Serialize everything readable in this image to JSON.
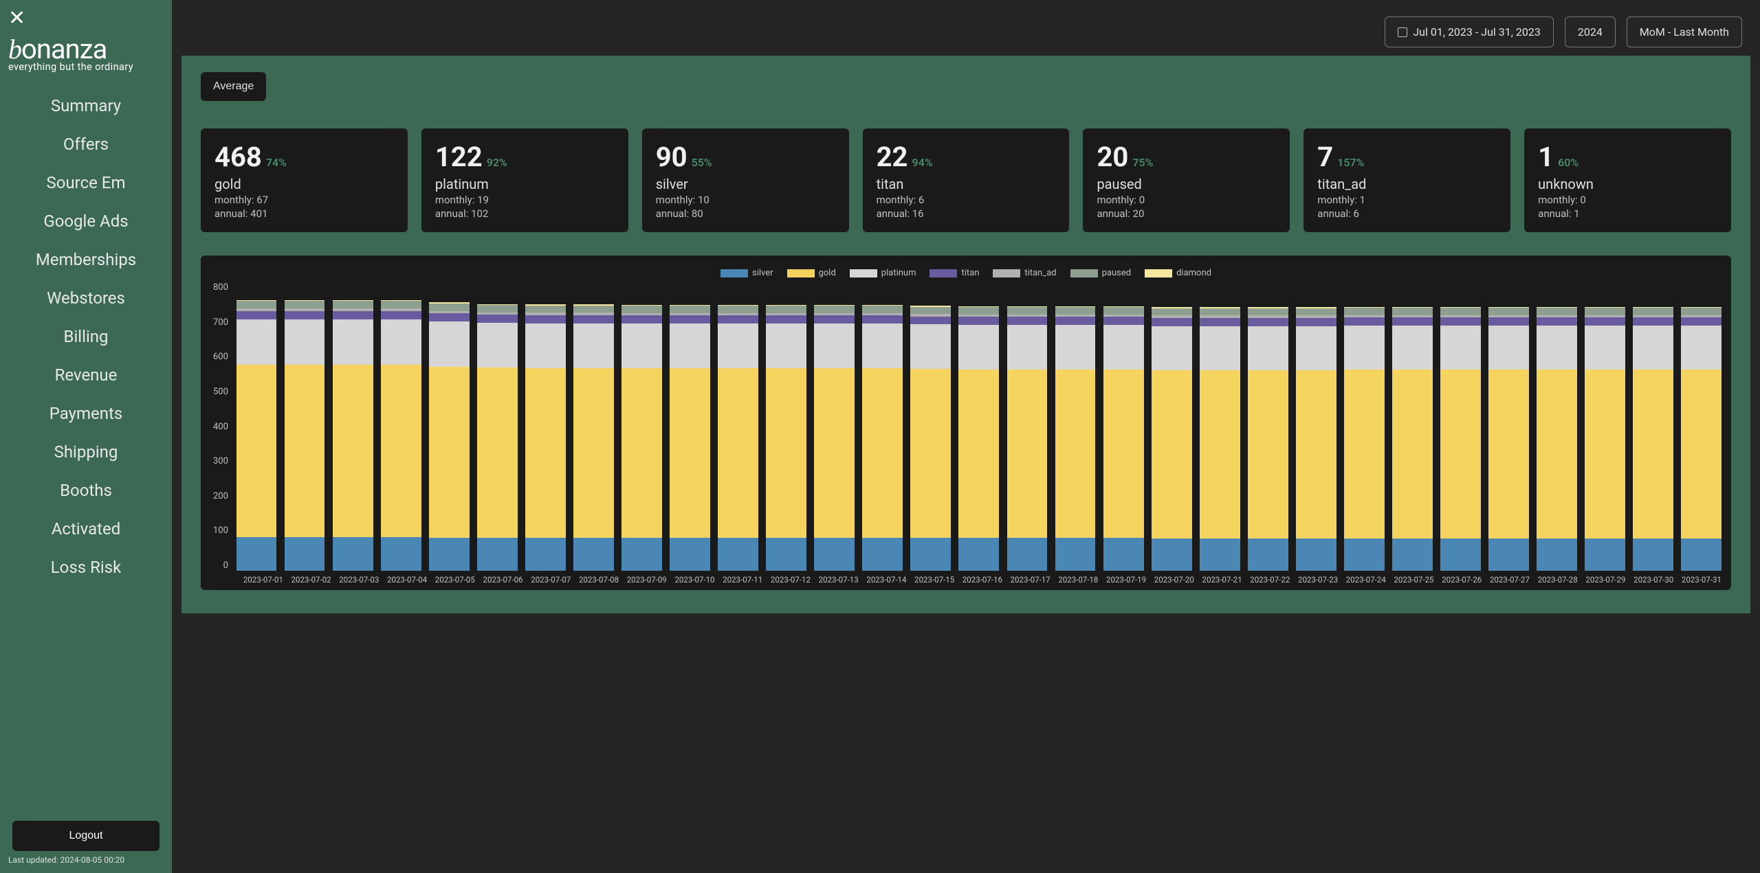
{
  "sidebar": {
    "logo_name": "bonanza",
    "logo_sub": "everything but the ordinary",
    "items": [
      "Summary",
      "Offers",
      "Source Em",
      "Google Ads",
      "Memberships",
      "Webstores",
      "Billing",
      "Revenue",
      "Payments",
      "Shipping",
      "Booths",
      "Activated",
      "Loss Risk"
    ],
    "logout": "Logout",
    "last_updated": "Last updated: 2024-08-05 00:20"
  },
  "topbar": {
    "date_range": "Jul 01, 2023 - Jul 31, 2023",
    "year": "2024",
    "mom": "MoM - Last Month"
  },
  "average_btn": "Average",
  "cards": [
    {
      "value": "468",
      "pct": "74%",
      "label": "gold",
      "monthly": "monthly: 67",
      "annual": "annual: 401"
    },
    {
      "value": "122",
      "pct": "92%",
      "label": "platinum",
      "monthly": "monthly: 19",
      "annual": "annual: 102"
    },
    {
      "value": "90",
      "pct": "55%",
      "label": "silver",
      "monthly": "monthly: 10",
      "annual": "annual: 80"
    },
    {
      "value": "22",
      "pct": "94%",
      "label": "titan",
      "monthly": "monthly: 6",
      "annual": "annual: 16"
    },
    {
      "value": "20",
      "pct": "75%",
      "label": "paused",
      "monthly": "monthly: 0",
      "annual": "annual: 20"
    },
    {
      "value": "7",
      "pct": "157%",
      "label": "titan_ad",
      "monthly": "monthly: 1",
      "annual": "annual: 6"
    },
    {
      "value": "1",
      "pct": "60%",
      "label": "unknown",
      "monthly": "monthly: 0",
      "annual": "annual: 1"
    }
  ],
  "chart_data": {
    "type": "bar",
    "title": "",
    "ylim": [
      0,
      800
    ],
    "y_ticks": [
      "800",
      "700",
      "600",
      "500",
      "400",
      "300",
      "200",
      "100",
      "0"
    ],
    "legend": [
      "silver",
      "gold",
      "platinum",
      "titan",
      "titan_ad",
      "paused",
      "diamond"
    ],
    "colors": {
      "silver": "#4a87b5",
      "gold": "#f4d35e",
      "platinum": "#d6d6d6",
      "titan": "#6a5a9e",
      "titan_ad": "#b0b0b0",
      "paused": "#8da08f",
      "diamond": "#f5e7a0"
    },
    "stack_order": [
      "silver",
      "gold",
      "platinum",
      "titan",
      "titan_ad",
      "paused",
      "diamond"
    ],
    "categories": [
      "2023-07-01",
      "2023-07-02",
      "2023-07-03",
      "2023-07-04",
      "2023-07-05",
      "2023-07-06",
      "2023-07-07",
      "2023-07-08",
      "2023-07-09",
      "2023-07-10",
      "2023-07-11",
      "2023-07-12",
      "2023-07-13",
      "2023-07-14",
      "2023-07-15",
      "2023-07-16",
      "2023-07-17",
      "2023-07-18",
      "2023-07-19",
      "2023-07-20",
      "2023-07-21",
      "2023-07-22",
      "2023-07-23",
      "2023-07-24",
      "2023-07-25",
      "2023-07-26",
      "2023-07-27",
      "2023-07-28",
      "2023-07-29",
      "2023-07-30",
      "2023-07-31"
    ],
    "series": [
      {
        "name": "silver",
        "values": [
          93,
          93,
          93,
          93,
          92,
          91,
          91,
          91,
          91,
          91,
          91,
          91,
          91,
          91,
          91,
          91,
          91,
          91,
          91,
          90,
          90,
          90,
          90,
          90,
          90,
          90,
          90,
          90,
          90,
          90,
          90
        ]
      },
      {
        "name": "gold",
        "values": [
          478,
          478,
          478,
          478,
          474,
          472,
          471,
          471,
          470,
          470,
          470,
          470,
          470,
          470,
          469,
          468,
          468,
          468,
          468,
          467,
          467,
          467,
          467,
          468,
          468,
          468,
          468,
          468,
          468,
          468,
          468
        ]
      },
      {
        "name": "platinum",
        "values": [
          126,
          126,
          126,
          126,
          125,
          124,
          124,
          124,
          124,
          124,
          124,
          124,
          124,
          124,
          123,
          123,
          123,
          123,
          123,
          122,
          122,
          122,
          122,
          122,
          122,
          122,
          122,
          122,
          122,
          122,
          122
        ]
      },
      {
        "name": "titan",
        "values": [
          24,
          24,
          24,
          24,
          23,
          23,
          23,
          23,
          23,
          23,
          23,
          23,
          23,
          23,
          22,
          22,
          22,
          22,
          22,
          22,
          22,
          22,
          22,
          22,
          22,
          22,
          22,
          22,
          22,
          22,
          22
        ]
      },
      {
        "name": "titan_ad",
        "values": [
          7,
          7,
          7,
          7,
          7,
          7,
          7,
          7,
          7,
          7,
          7,
          7,
          7,
          7,
          7,
          7,
          7,
          7,
          7,
          7,
          7,
          7,
          7,
          7,
          7,
          7,
          7,
          7,
          7,
          7,
          7
        ]
      },
      {
        "name": "paused",
        "values": [
          20,
          20,
          20,
          20,
          20,
          20,
          20,
          20,
          20,
          20,
          20,
          20,
          20,
          20,
          20,
          20,
          20,
          20,
          20,
          20,
          20,
          20,
          20,
          20,
          20,
          20,
          20,
          20,
          20,
          20,
          20
        ]
      },
      {
        "name": "diamond",
        "values": [
          3,
          3,
          3,
          3,
          3,
          3,
          3,
          3,
          3,
          3,
          3,
          3,
          3,
          3,
          3,
          3,
          3,
          3,
          3,
          3,
          3,
          3,
          3,
          3,
          3,
          3,
          3,
          3,
          3,
          3,
          3
        ]
      }
    ]
  }
}
